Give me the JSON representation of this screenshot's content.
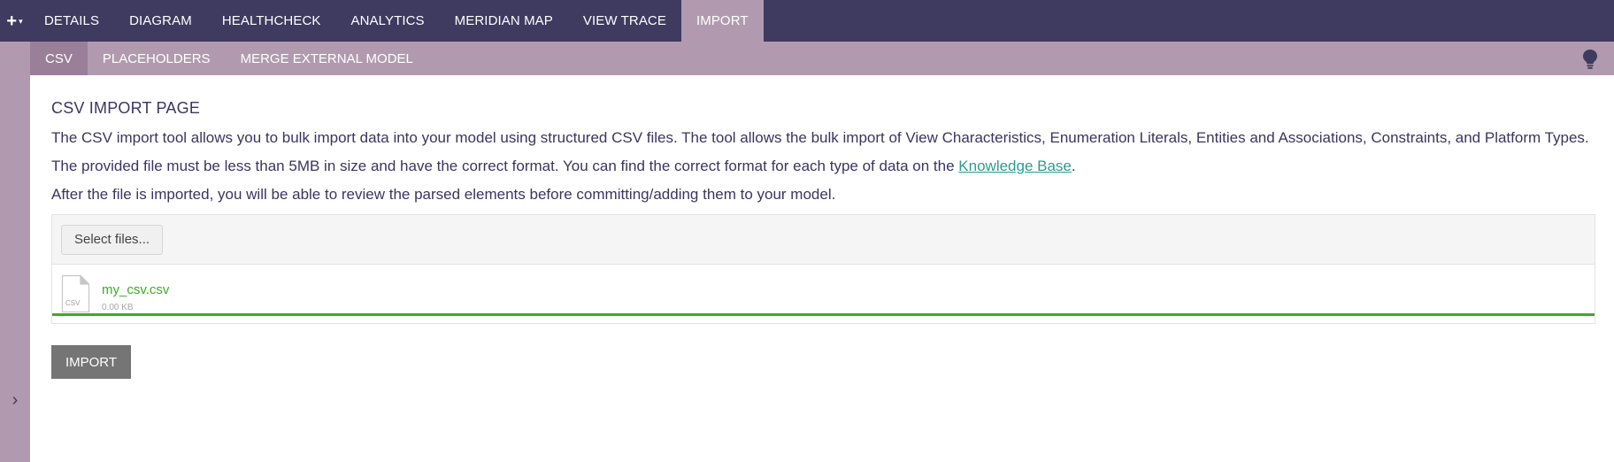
{
  "topnav": {
    "add_menu": {
      "plus": "+",
      "caret": "▾"
    },
    "tabs": [
      {
        "label": "DETAILS"
      },
      {
        "label": "DIAGRAM"
      },
      {
        "label": "HEALTHCHECK"
      },
      {
        "label": "ANALYTICS"
      },
      {
        "label": "MERIDIAN MAP"
      },
      {
        "label": "VIEW TRACE"
      },
      {
        "label": "IMPORT",
        "active": true
      }
    ]
  },
  "subnav": {
    "tabs": [
      {
        "label": "CSV",
        "active": true
      },
      {
        "label": "PLACEHOLDERS"
      },
      {
        "label": "MERGE EXTERNAL MODEL"
      }
    ],
    "help_icon": "lightbulb-icon"
  },
  "rail": {
    "toggle_icon": "chevron-right-icon",
    "toggle_glyph": "›"
  },
  "main": {
    "title": "CSV IMPORT PAGE",
    "paragraph1": "The CSV import tool allows you to bulk import data into your model using structured CSV files. The tool allows the bulk import of View Characteristics, Enumeration Literals, Entities and Associations, Constraints, and Platform Types.",
    "paragraph2_prefix": "The provided file must be less than 5MB in size and have the correct format. You can find the correct format for each type of data on the ",
    "paragraph2_link": "Knowledge Base",
    "paragraph2_suffix": ".",
    "paragraph3": "After the file is imported, you will be able to review the parsed elements before committing/adding them to your model.",
    "upload": {
      "select_label": "Select files...",
      "file": {
        "icon_label": "CSV",
        "name": "my_csv.csv",
        "size": "0.00 KB",
        "progress_percent": 100
      }
    },
    "import_label": "IMPORT"
  },
  "colors": {
    "topnav_bg": "#3e3a60",
    "subnav_bg": "#b19aaf",
    "active_subtab_bg": "#9a7f98",
    "success_green": "#3aad24",
    "link_teal": "#2a9d8f",
    "import_button_bg": "#757575"
  }
}
